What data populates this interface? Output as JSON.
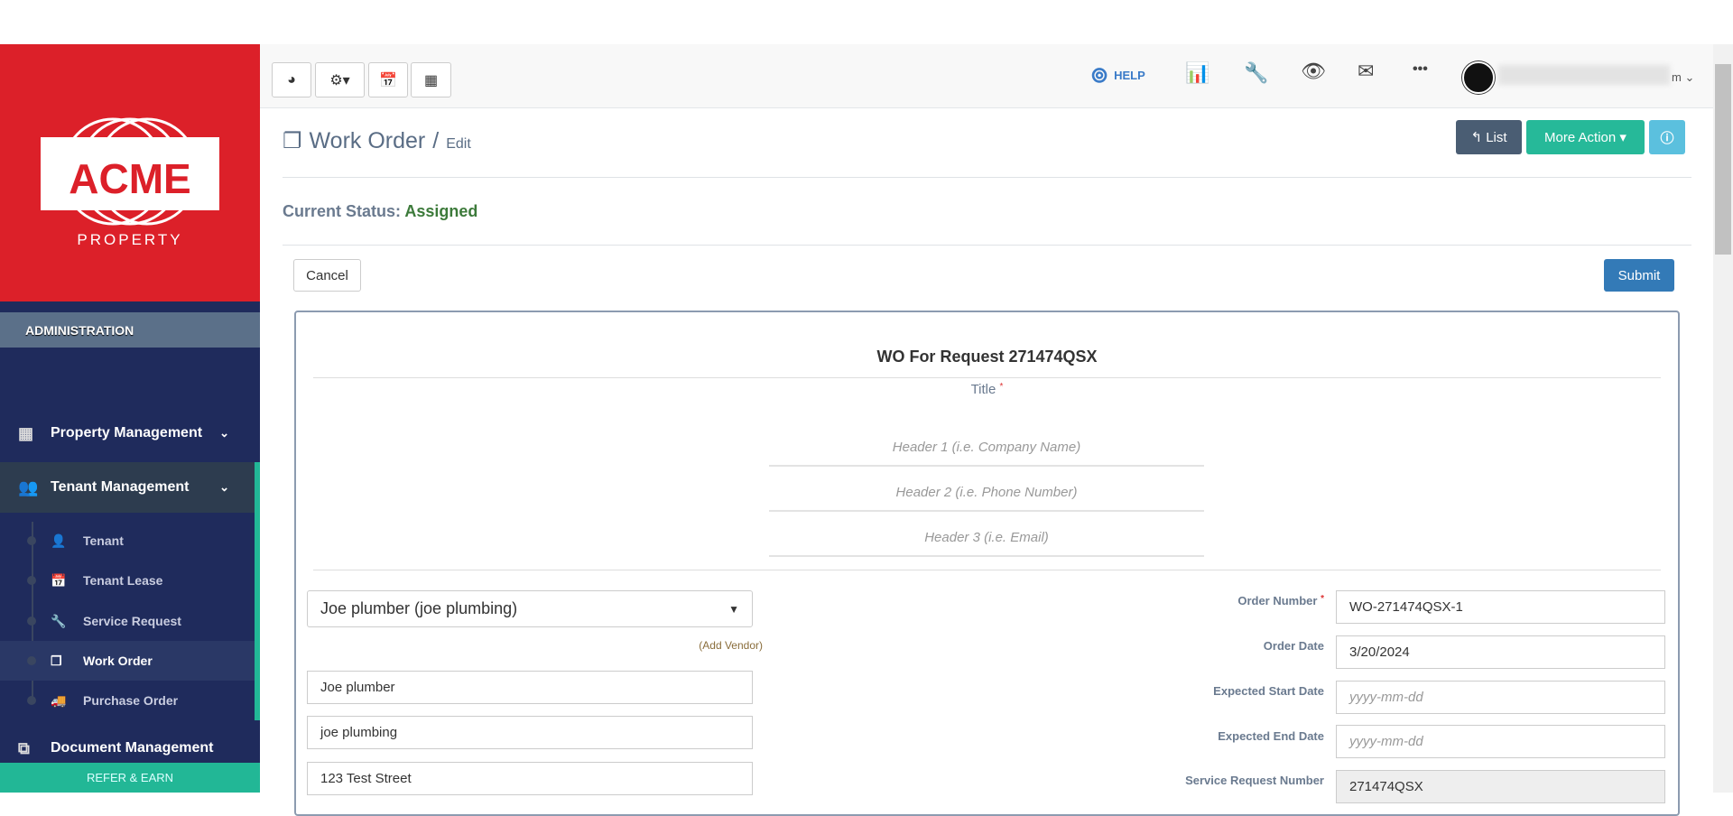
{
  "logo": {
    "brand": "ACME",
    "sub": "PROPERTY"
  },
  "sidebar": {
    "section": "ADMINISTRATION",
    "items": [
      {
        "label": "Property Management",
        "icon": "building-icon"
      },
      {
        "label": "Tenant Management",
        "icon": "users-icon"
      }
    ],
    "sub_items": [
      {
        "label": "Tenant"
      },
      {
        "label": "Tenant Lease"
      },
      {
        "label": "Service Request"
      },
      {
        "label": "Work Order"
      },
      {
        "label": "Purchase Order"
      }
    ],
    "doc": "Document Management",
    "refer": "REFER & EARN"
  },
  "topbar": {
    "help": "HELP",
    "user_suffix": "m"
  },
  "page": {
    "title": "Work Order",
    "sep": "/",
    "sub": "Edit",
    "status_label": "Current Status:",
    "status": "Assigned",
    "list": "List",
    "more": "More Action",
    "cancel": "Cancel",
    "submit": "Submit"
  },
  "form": {
    "heading": "WO For Request 271474QSX",
    "title_label": "Title",
    "req": "*",
    "header1": "Header 1 (i.e. Company Name)",
    "header2": "Header 2 (i.e. Phone Number)",
    "header3": "Header 3 (i.e. Email)",
    "vendor": "Joe plumber (joe plumbing)",
    "add_vendor": "(Add Vendor)",
    "vendor_name": "Joe  plumber",
    "vendor_company": "joe plumbing",
    "vendor_address": "123 Test Street",
    "order_number_label": "Order Number",
    "order_number": "WO-271474QSX-1",
    "order_date_label": "Order Date",
    "order_date": "3/20/2024",
    "start_label": "Expected Start Date",
    "end_label": "Expected End Date",
    "date_ph": "yyyy-mm-dd",
    "sr_label": "Service Request Number",
    "sr": "271474QSX"
  }
}
